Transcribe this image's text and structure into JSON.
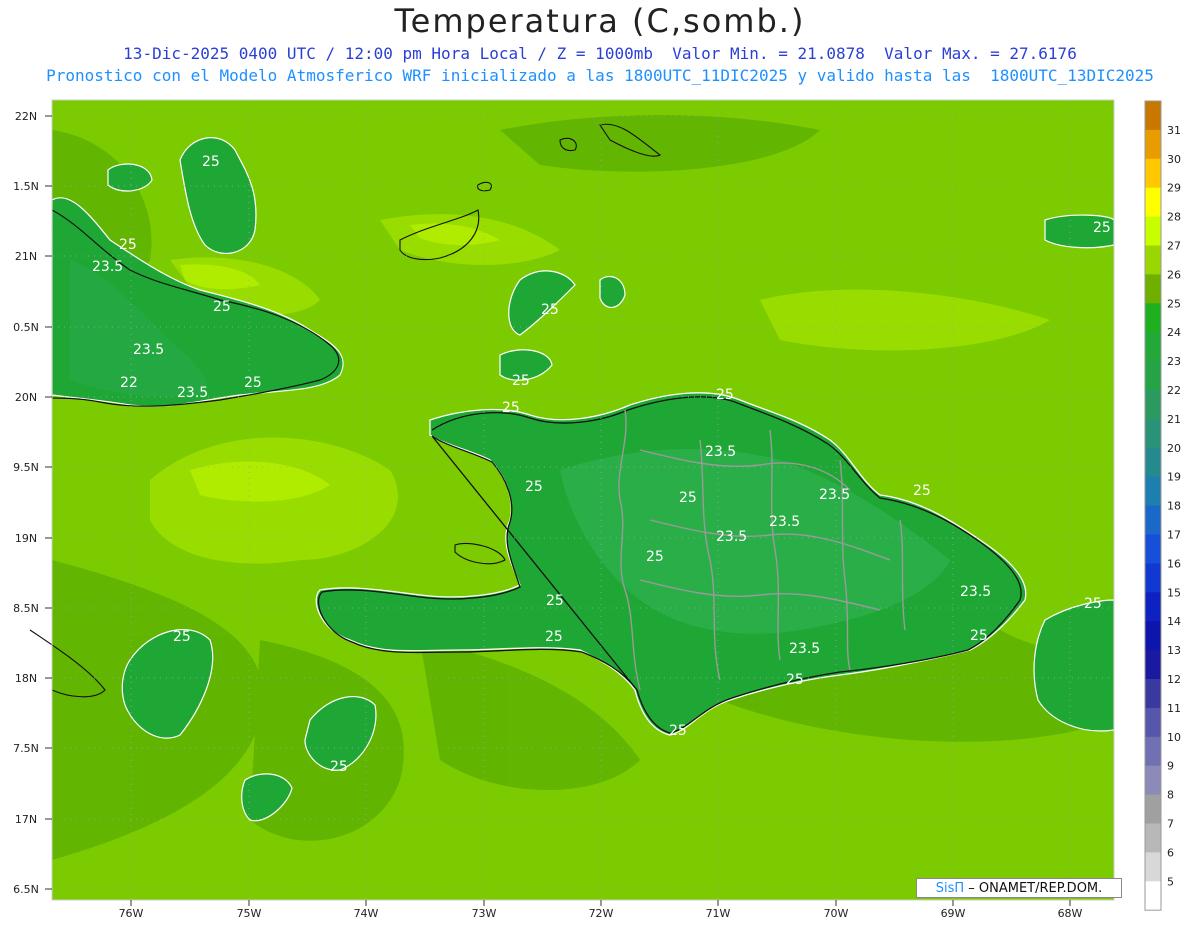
{
  "header": {
    "title": "Temperatura (C,somb.)",
    "line1": "13-Dic-2025 0400 UTC / 12:00 pm Hora Local / Z = 1000mb  Valor Min. = 21.0878  Valor Max. = 27.6176",
    "line2": "Pronostico con el Modelo Atmosferico WRF inicializado a las 1800UTC_11DIC2025 y valido hasta las  1800UTC_13DIC2025"
  },
  "map": {
    "lat_labels": [
      "22N",
      "1.5N",
      "21N",
      "0.5N",
      "20N",
      "9.5N",
      "19N",
      "8.5N",
      "18N",
      "7.5N",
      "17N",
      "6.5N"
    ],
    "lon_labels": [
      "76W",
      "75W",
      "74W",
      "73W",
      "72W",
      "71W",
      "70W",
      "69W",
      "68W"
    ],
    "contour_labels": [
      "25",
      "25",
      "23.5",
      "25",
      "23.5",
      "22",
      "23.5",
      "25",
      "25",
      "25",
      "25",
      "25",
      "25",
      "23.5",
      "25",
      "23.5",
      "23.5",
      "23.5",
      "25",
      "25",
      "23.5",
      "25",
      "25",
      "25",
      "25",
      "25",
      "25"
    ],
    "colors": {
      "land_high": "#16a02c",
      "land_mid": "#33b833",
      "sea_base": "#73c400",
      "sea_light": "#8fd400",
      "sea_bright": "#b4f000",
      "country_border": "#9a9a9a"
    }
  },
  "colorbar": {
    "labels": [
      "31",
      "30",
      "29",
      "28",
      "27",
      "26",
      "25",
      "24",
      "23",
      "22",
      "21",
      "20",
      "19",
      "18",
      "17",
      "16",
      "15",
      "14",
      "13",
      "12",
      "11",
      "10",
      "9",
      "8",
      "7",
      "6",
      "5"
    ],
    "colors": [
      "#c87800",
      "#e89c00",
      "#ffc800",
      "#ffff00",
      "#c8ff00",
      "#9bd600",
      "#6eaf00",
      "#1fb01f",
      "#24a838",
      "#26a346",
      "#2a9a5e",
      "#2a9277",
      "#248a8e",
      "#1d7eb0",
      "#1a68c8",
      "#1650d8",
      "#1238d2",
      "#0e22c2",
      "#0d15ac",
      "#1a1aa0",
      "#3a3a9e",
      "#5656aa",
      "#7070b2",
      "#8c8ab8",
      "#a0a0a0",
      "#b8b8b8",
      "#d8d8d8",
      "#ffffff"
    ]
  },
  "credit": {
    "brand": "SisΠ",
    "text": " – ONAMET/REP.DOM."
  }
}
